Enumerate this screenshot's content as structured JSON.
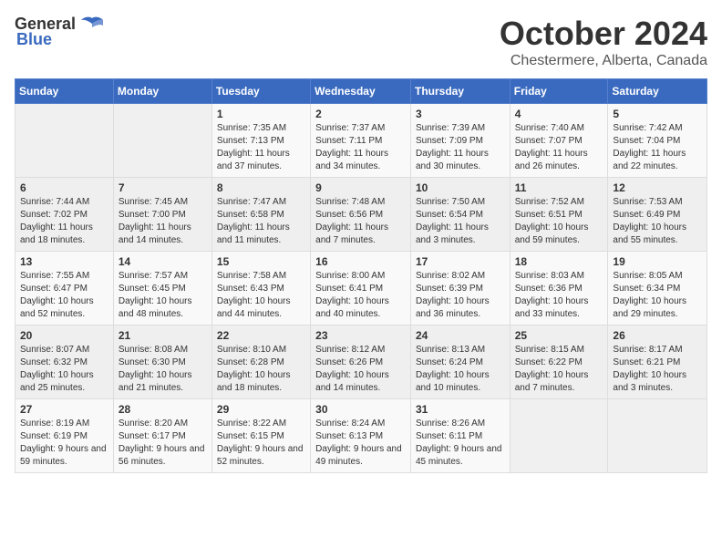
{
  "logo": {
    "general": "General",
    "blue": "Blue"
  },
  "title": "October 2024",
  "subtitle": "Chestermere, Alberta, Canada",
  "weekdays": [
    "Sunday",
    "Monday",
    "Tuesday",
    "Wednesday",
    "Thursday",
    "Friday",
    "Saturday"
  ],
  "weeks": [
    [
      {
        "day": "",
        "info": ""
      },
      {
        "day": "",
        "info": ""
      },
      {
        "day": "1",
        "info": "Sunrise: 7:35 AM\nSunset: 7:13 PM\nDaylight: 11 hours and 37 minutes."
      },
      {
        "day": "2",
        "info": "Sunrise: 7:37 AM\nSunset: 7:11 PM\nDaylight: 11 hours and 34 minutes."
      },
      {
        "day": "3",
        "info": "Sunrise: 7:39 AM\nSunset: 7:09 PM\nDaylight: 11 hours and 30 minutes."
      },
      {
        "day": "4",
        "info": "Sunrise: 7:40 AM\nSunset: 7:07 PM\nDaylight: 11 hours and 26 minutes."
      },
      {
        "day": "5",
        "info": "Sunrise: 7:42 AM\nSunset: 7:04 PM\nDaylight: 11 hours and 22 minutes."
      }
    ],
    [
      {
        "day": "6",
        "info": "Sunrise: 7:44 AM\nSunset: 7:02 PM\nDaylight: 11 hours and 18 minutes."
      },
      {
        "day": "7",
        "info": "Sunrise: 7:45 AM\nSunset: 7:00 PM\nDaylight: 11 hours and 14 minutes."
      },
      {
        "day": "8",
        "info": "Sunrise: 7:47 AM\nSunset: 6:58 PM\nDaylight: 11 hours and 11 minutes."
      },
      {
        "day": "9",
        "info": "Sunrise: 7:48 AM\nSunset: 6:56 PM\nDaylight: 11 hours and 7 minutes."
      },
      {
        "day": "10",
        "info": "Sunrise: 7:50 AM\nSunset: 6:54 PM\nDaylight: 11 hours and 3 minutes."
      },
      {
        "day": "11",
        "info": "Sunrise: 7:52 AM\nSunset: 6:51 PM\nDaylight: 10 hours and 59 minutes."
      },
      {
        "day": "12",
        "info": "Sunrise: 7:53 AM\nSunset: 6:49 PM\nDaylight: 10 hours and 55 minutes."
      }
    ],
    [
      {
        "day": "13",
        "info": "Sunrise: 7:55 AM\nSunset: 6:47 PM\nDaylight: 10 hours and 52 minutes."
      },
      {
        "day": "14",
        "info": "Sunrise: 7:57 AM\nSunset: 6:45 PM\nDaylight: 10 hours and 48 minutes."
      },
      {
        "day": "15",
        "info": "Sunrise: 7:58 AM\nSunset: 6:43 PM\nDaylight: 10 hours and 44 minutes."
      },
      {
        "day": "16",
        "info": "Sunrise: 8:00 AM\nSunset: 6:41 PM\nDaylight: 10 hours and 40 minutes."
      },
      {
        "day": "17",
        "info": "Sunrise: 8:02 AM\nSunset: 6:39 PM\nDaylight: 10 hours and 36 minutes."
      },
      {
        "day": "18",
        "info": "Sunrise: 8:03 AM\nSunset: 6:36 PM\nDaylight: 10 hours and 33 minutes."
      },
      {
        "day": "19",
        "info": "Sunrise: 8:05 AM\nSunset: 6:34 PM\nDaylight: 10 hours and 29 minutes."
      }
    ],
    [
      {
        "day": "20",
        "info": "Sunrise: 8:07 AM\nSunset: 6:32 PM\nDaylight: 10 hours and 25 minutes."
      },
      {
        "day": "21",
        "info": "Sunrise: 8:08 AM\nSunset: 6:30 PM\nDaylight: 10 hours and 21 minutes."
      },
      {
        "day": "22",
        "info": "Sunrise: 8:10 AM\nSunset: 6:28 PM\nDaylight: 10 hours and 18 minutes."
      },
      {
        "day": "23",
        "info": "Sunrise: 8:12 AM\nSunset: 6:26 PM\nDaylight: 10 hours and 14 minutes."
      },
      {
        "day": "24",
        "info": "Sunrise: 8:13 AM\nSunset: 6:24 PM\nDaylight: 10 hours and 10 minutes."
      },
      {
        "day": "25",
        "info": "Sunrise: 8:15 AM\nSunset: 6:22 PM\nDaylight: 10 hours and 7 minutes."
      },
      {
        "day": "26",
        "info": "Sunrise: 8:17 AM\nSunset: 6:21 PM\nDaylight: 10 hours and 3 minutes."
      }
    ],
    [
      {
        "day": "27",
        "info": "Sunrise: 8:19 AM\nSunset: 6:19 PM\nDaylight: 9 hours and 59 minutes."
      },
      {
        "day": "28",
        "info": "Sunrise: 8:20 AM\nSunset: 6:17 PM\nDaylight: 9 hours and 56 minutes."
      },
      {
        "day": "29",
        "info": "Sunrise: 8:22 AM\nSunset: 6:15 PM\nDaylight: 9 hours and 52 minutes."
      },
      {
        "day": "30",
        "info": "Sunrise: 8:24 AM\nSunset: 6:13 PM\nDaylight: 9 hours and 49 minutes."
      },
      {
        "day": "31",
        "info": "Sunrise: 8:26 AM\nSunset: 6:11 PM\nDaylight: 9 hours and 45 minutes."
      },
      {
        "day": "",
        "info": ""
      },
      {
        "day": "",
        "info": ""
      }
    ]
  ]
}
